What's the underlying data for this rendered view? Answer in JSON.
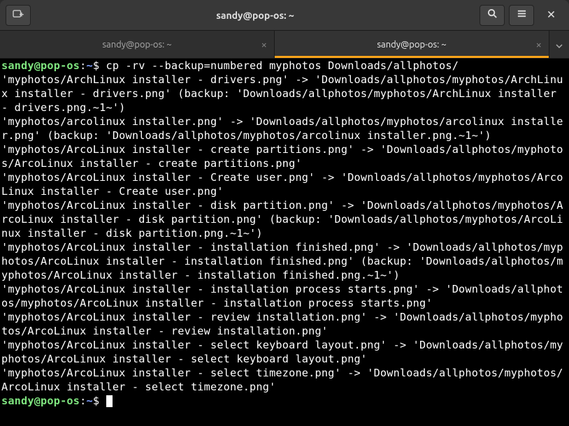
{
  "window": {
    "title": "sandy@pop-os: ~"
  },
  "tabs": [
    {
      "label": "sandy@pop-os: ~",
      "active": false
    },
    {
      "label": "sandy@pop-os: ~",
      "active": true
    }
  ],
  "prompt": {
    "user_host": "sandy@pop-os",
    "separator": ":",
    "path": "~",
    "sigil": "$"
  },
  "command": "cp -rv --backup=numbered myphotos Downloads/allphotos/",
  "output_lines": [
    "'myphotos/ArchLinux installer - drivers.png' -> 'Downloads/allphotos/myphotos/ArchLinux installer - drivers.png' (backup: 'Downloads/allphotos/myphotos/ArchLinux installer - drivers.png.~1~')",
    "'myphotos/arcolinux installer.png' -> 'Downloads/allphotos/myphotos/arcolinux installer.png' (backup: 'Downloads/allphotos/myphotos/arcolinux installer.png.~1~')",
    "'myphotos/ArcoLinux installer - create partitions.png' -> 'Downloads/allphotos/myphotos/ArcoLinux installer - create partitions.png'",
    "'myphotos/ArcoLinux installer - Create user.png' -> 'Downloads/allphotos/myphotos/ArcoLinux installer - Create user.png'",
    "'myphotos/ArcoLinux installer - disk partition.png' -> 'Downloads/allphotos/myphotos/ArcoLinux installer - disk partition.png' (backup: 'Downloads/allphotos/myphotos/ArcoLinux installer - disk partition.png.~1~')",
    "'myphotos/ArcoLinux installer - installation finished.png' -> 'Downloads/allphotos/myphotos/ArcoLinux installer - installation finished.png' (backup: 'Downloads/allphotos/myphotos/ArcoLinux installer - installation finished.png.~1~')",
    "'myphotos/ArcoLinux installer - installation process starts.png' -> 'Downloads/allphotos/myphotos/ArcoLinux installer - installation process starts.png'",
    "'myphotos/ArcoLinux installer - review installation.png' -> 'Downloads/allphotos/myphotos/ArcoLinux installer - review installation.png'",
    "'myphotos/ArcoLinux installer - select keyboard layout.png' -> 'Downloads/allphotos/myphotos/ArcoLinux installer - select keyboard layout.png'",
    "'myphotos/ArcoLinux installer - select timezone.png' -> 'Downloads/allphotos/myphotos/ArcoLinux installer - select timezone.png'"
  ]
}
